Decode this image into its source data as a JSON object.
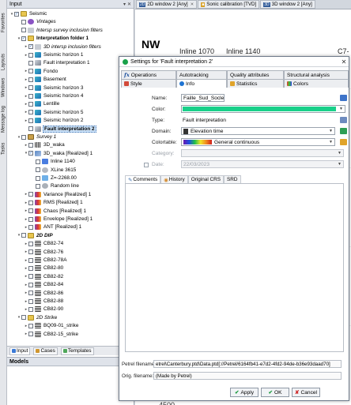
{
  "side_tabs": [
    "Favorites",
    "Layouts",
    "Windows",
    "Message log",
    "Tasks"
  ],
  "input_panel": {
    "title": "Input",
    "tree": [
      {
        "label": "Seismic",
        "level": 0,
        "style": "normal",
        "icon": "folder",
        "checked": true,
        "expander": "▾"
      },
      {
        "label": "Vintages",
        "level": 1,
        "style": "italic",
        "icon": "vintage",
        "checked": false,
        "expander": ""
      },
      {
        "label": "Intersp survey inclusion filters",
        "level": 1,
        "style": "italic",
        "icon": "filter",
        "checked": false,
        "expander": ""
      },
      {
        "label": "Interpretation folder 1",
        "level": 1,
        "style": "bold",
        "icon": "folder",
        "checked": true,
        "expander": "▾"
      },
      {
        "label": "3D intersp inclusion filters",
        "level": 2,
        "style": "italic",
        "icon": "filter",
        "checked": true,
        "expander": "▸"
      },
      {
        "label": "Seismic horizon 1",
        "level": 2,
        "style": "normal",
        "icon": "horizon",
        "checked": false,
        "expander": "▸"
      },
      {
        "label": "Fault interpretation 1",
        "level": 2,
        "style": "normal",
        "icon": "fault",
        "checked": false,
        "expander": ""
      },
      {
        "label": "Fondo",
        "level": 2,
        "style": "normal",
        "icon": "horizon",
        "checked": false,
        "expander": "▸"
      },
      {
        "label": "Basement",
        "level": 2,
        "style": "normal",
        "icon": "horizon",
        "checked": false,
        "expander": "▸"
      },
      {
        "label": "Seismic horizon 3",
        "level": 2,
        "style": "normal",
        "icon": "horizon",
        "checked": false,
        "expander": "▸"
      },
      {
        "label": "Seismic horizon 4",
        "level": 2,
        "style": "normal",
        "icon": "horizon",
        "checked": false,
        "expander": "▸"
      },
      {
        "label": "Lentille",
        "level": 2,
        "style": "normal",
        "icon": "horizon",
        "checked": false,
        "expander": "▸"
      },
      {
        "label": "Seismic horizon 5",
        "level": 2,
        "style": "normal",
        "icon": "horizon",
        "checked": false,
        "expander": "▸"
      },
      {
        "label": "Seismic horizon 2",
        "level": 2,
        "style": "normal",
        "icon": "horizon",
        "checked": false,
        "expander": "▸"
      },
      {
        "label": "Fault interpretation 2",
        "level": 2,
        "style": "bold",
        "icon": "fault",
        "checked": false,
        "expander": "",
        "selected": true
      },
      {
        "label": "Survey 1",
        "level": 1,
        "style": "italic",
        "icon": "survey",
        "checked": false,
        "expander": "▾"
      },
      {
        "label": "3D_waka",
        "level": 2,
        "style": "normal",
        "icon": "seis",
        "checked": false,
        "expander": "▸"
      },
      {
        "label": "3D_waka [Realized] 1",
        "level": 2,
        "style": "normal",
        "icon": "cube",
        "checked": true,
        "expander": "▾"
      },
      {
        "label": "Inline 1140",
        "level": 3,
        "style": "normal",
        "icon": "inline",
        "checked": false,
        "expander": ""
      },
      {
        "label": "XLine 3615",
        "level": 3,
        "style": "normal",
        "icon": "xline",
        "checked": false,
        "expander": ""
      },
      {
        "label": "Z=-2268.00",
        "level": 3,
        "style": "normal",
        "icon": "z",
        "checked": false,
        "expander": ""
      },
      {
        "label": "Random line",
        "level": 3,
        "style": "normal",
        "icon": "rline",
        "checked": false,
        "expander": ""
      },
      {
        "label": "Variance [Realized] 1",
        "level": 2,
        "style": "normal",
        "icon": "attr",
        "checked": false,
        "expander": "▸"
      },
      {
        "label": "RMS [Realized] 1",
        "level": 2,
        "style": "normal",
        "icon": "attr",
        "checked": false,
        "expander": "▸"
      },
      {
        "label": "Chaos [Realized] 1",
        "level": 2,
        "style": "normal",
        "icon": "attr",
        "checked": false,
        "expander": "▸"
      },
      {
        "label": "Envelope [Realized] 1",
        "level": 2,
        "style": "normal",
        "icon": "attr",
        "checked": false,
        "expander": "▸"
      },
      {
        "label": "ANT [Realized] 1",
        "level": 2,
        "style": "normal",
        "icon": "attr",
        "checked": false,
        "expander": "▸"
      },
      {
        "label": "2D DIP",
        "level": 1,
        "style": "bolditalic",
        "icon": "folder",
        "checked": false,
        "expander": "▾"
      },
      {
        "label": "CB82-74",
        "level": 2,
        "style": "normal",
        "icon": "line2d",
        "checked": false,
        "expander": "▸"
      },
      {
        "label": "CB82-76",
        "level": 2,
        "style": "normal",
        "icon": "line2d",
        "checked": false,
        "expander": "▸"
      },
      {
        "label": "CB82-78A",
        "level": 2,
        "style": "normal",
        "icon": "line2d",
        "checked": false,
        "expander": "▸"
      },
      {
        "label": "CB82-80",
        "level": 2,
        "style": "normal",
        "icon": "line2d",
        "checked": false,
        "expander": "▸"
      },
      {
        "label": "CB82-82",
        "level": 2,
        "style": "normal",
        "icon": "line2d",
        "checked": false,
        "expander": "▸"
      },
      {
        "label": "CB82-84",
        "level": 2,
        "style": "normal",
        "icon": "line2d",
        "checked": false,
        "expander": "▸"
      },
      {
        "label": "CB82-86",
        "level": 2,
        "style": "normal",
        "icon": "line2d",
        "checked": false,
        "expander": "▸"
      },
      {
        "label": "CB82-88",
        "level": 2,
        "style": "normal",
        "icon": "line2d",
        "checked": false,
        "expander": "▸"
      },
      {
        "label": "CB82-90",
        "level": 2,
        "style": "normal",
        "icon": "line2d",
        "checked": false,
        "expander": "▸"
      },
      {
        "label": "2D Strike",
        "level": 1,
        "style": "italic",
        "icon": "folder",
        "checked": false,
        "expander": "▾"
      },
      {
        "label": "BQ09-01_strike",
        "level": 2,
        "style": "normal",
        "icon": "line2d",
        "checked": false,
        "expander": "▸"
      },
      {
        "label": "CB82-15_strike",
        "level": 2,
        "style": "normal",
        "icon": "line2d",
        "checked": false,
        "expander": "▸"
      }
    ]
  },
  "bottom_tabs": [
    "Input",
    "Cases",
    "Templates"
  ],
  "models_panel": {
    "title": "Models"
  },
  "window_tabs": [
    {
      "badge": "2D",
      "label": "2D window 2 [Any]"
    },
    {
      "badge": "",
      "label": "Sonic calibration [TVD]"
    },
    {
      "badge": "3D",
      "label": "3D window 2 [Any]"
    }
  ],
  "canvas": {
    "nw_label": "NW",
    "inline_labels": [
      "Inline 1070",
      "Inline 1140"
    ],
    "right_label": "C7-",
    "depth_label": "4500"
  },
  "dialog": {
    "title": "Settings for 'Fault interpretation 2'",
    "top_tabs": [
      "Operations",
      "Autotracking",
      "Quality attributes",
      "Structural analysis"
    ],
    "bottom_tabs": [
      "Style",
      "Info",
      "Statistics",
      "Colors"
    ],
    "active_tab": "Info",
    "fields": {
      "name_label": "Name:",
      "name_value": "Faille_Sud_Socle",
      "color_label": "Color:",
      "color_value": "#19d08a",
      "type_label": "Type:",
      "type_value": "Fault interpretation",
      "domain_label": "Domain:",
      "domain_value": "Elevation time",
      "colortable_label": "Colortable:",
      "colortable_value": "General continuous",
      "category_label": "Category:",
      "date_label": "Date:",
      "date_value": "22/03/2023"
    },
    "sub_tabs": [
      "Comments",
      "History",
      "Original CRS",
      "SRD"
    ],
    "petrel_filename_label": "Petrel filename:",
    "petrel_filename_value": "etrel\\Canterbury.ptd\\Data.ptd[://Petrel/6164fb41-e7d2-4fd2-94de-b36e93daad70]",
    "orig_filename_label": "Orig. filename:",
    "orig_filename_value": "(Made by Petrel)",
    "buttons": {
      "apply": "Apply",
      "ok": "OK",
      "cancel": "Cancel"
    }
  }
}
